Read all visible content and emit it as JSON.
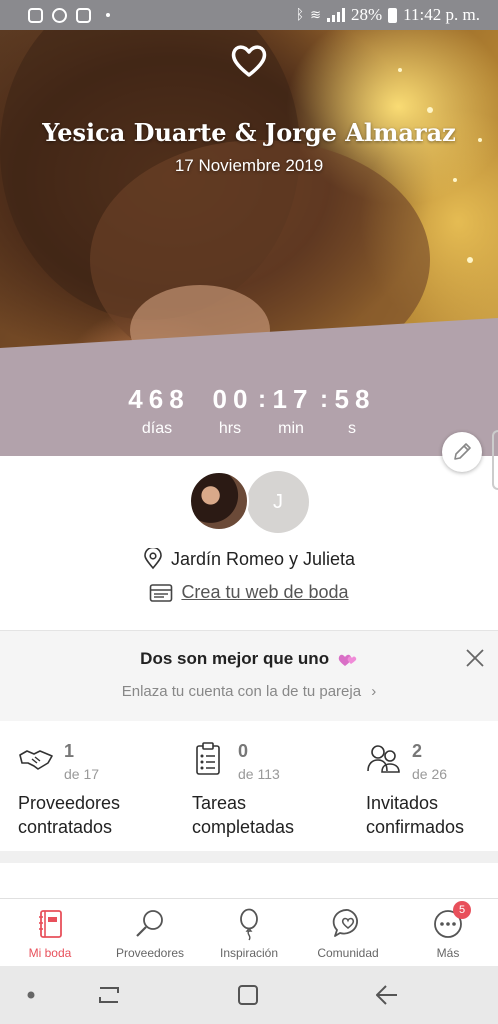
{
  "status_bar": {
    "battery": "28%",
    "time": "11:42 p. m.",
    "icons": [
      "instagram-icon",
      "pinterest-icon",
      "instagram-icon",
      "dot-icon",
      "bluetooth-icon",
      "wifi-icon",
      "signal-icon",
      "battery-icon"
    ]
  },
  "hero": {
    "title": "Yesica Duarte & Jorge Almaraz",
    "date": "17 Noviembre 2019",
    "icon": "heart-icon"
  },
  "countdown": {
    "days": "468",
    "hours": "00",
    "minutes": "17",
    "seconds": "58",
    "days_label": "días",
    "hours_label": "hrs",
    "minutes_label": "min",
    "seconds_label": "s"
  },
  "couple": {
    "partner_initial": "J",
    "venue": "Jardín Romeo y Julieta",
    "web_link": "Crea tu web de boda"
  },
  "partner_card": {
    "title": "Dos son mejor que uno",
    "subtitle": "Enlaza tu cuenta con la de tu pareja"
  },
  "stats": [
    {
      "icon": "handshake-icon",
      "count": "1",
      "of": "de 17",
      "label_line1": "Proveedores",
      "label_line2": "contratados"
    },
    {
      "icon": "clipboard-icon",
      "count": "0",
      "of": "de 113",
      "label_line1": "Tareas",
      "label_line2": "completadas"
    },
    {
      "icon": "guests-icon",
      "count": "2",
      "of": "de 26",
      "label_line1": "Invitados",
      "label_line2": "confirmados"
    }
  ],
  "bottom_nav": [
    {
      "label": "Mi boda",
      "icon": "notebook-icon",
      "active": true
    },
    {
      "label": "Proveedores",
      "icon": "search-icon",
      "active": false
    },
    {
      "label": "Inspiración",
      "icon": "balloon-icon",
      "active": false
    },
    {
      "label": "Comunidad",
      "icon": "chat-heart-icon",
      "active": false
    },
    {
      "label": "Más",
      "icon": "more-icon",
      "active": false,
      "badge": "5"
    }
  ],
  "colors": {
    "accent": "#e8505b",
    "band": "#b2a2ab",
    "status_bar": "#8a8a8e"
  }
}
